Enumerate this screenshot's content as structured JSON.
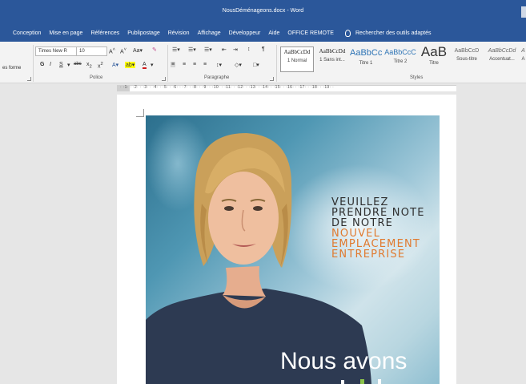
{
  "window": {
    "title": "NousDéménageons.docx - Word"
  },
  "menu": {
    "tabs": [
      "Conception",
      "Mise en page",
      "Références",
      "Publipostage",
      "Révision",
      "Affichage",
      "Développeur",
      "Aide",
      "OFFICE REMOTE"
    ],
    "tell_me": "Rechercher des outils adaptés"
  },
  "ribbon": {
    "clipboard_partial": "es forme",
    "font": {
      "name": "Times New R",
      "size": "10",
      "group_label": "Police"
    },
    "paragraph": {
      "group_label": "Paragraphe"
    },
    "styles": {
      "group_label": "Styles",
      "items": [
        {
          "sample": "AaBbCcDd",
          "label": "1 Normal"
        },
        {
          "sample": "AaBbCcDd",
          "label": "1 Sans int..."
        },
        {
          "sample": "AaBbCc",
          "label": "Titre 1"
        },
        {
          "sample": "AaBbCcC",
          "label": "Titre 2"
        },
        {
          "sample": "AaB",
          "label": "Titre"
        },
        {
          "sample": "AaBbCcD",
          "label": "Sous-titre"
        },
        {
          "sample": "AaBbCcDd",
          "label": "Accentuat..."
        },
        {
          "sample": "A",
          "label": "A"
        }
      ]
    }
  },
  "ruler": {
    "marks": "· ·1· · ·2· · ·3· · ·4· · ·5· · ·6· · ·7· · ·8· · ·9· · ·10· · ·11· · ·12· · ·13· · ·14· · ·15· · ·16· · ·17· · ·18· · ·19· ·"
  },
  "document": {
    "headline_dark": [
      "VEUILLEZ",
      "PRENDRE NOTE",
      "DE NOTRE"
    ],
    "headline_accent": [
      "NOUVEL",
      "EMPLACEMENT",
      "ENTREPRISE"
    ],
    "big_text": "Nous avons"
  },
  "colors": {
    "titlebar": "#2b579a",
    "accent_orange": "#e07a2f",
    "headline_dark": "#2e2e2e"
  }
}
